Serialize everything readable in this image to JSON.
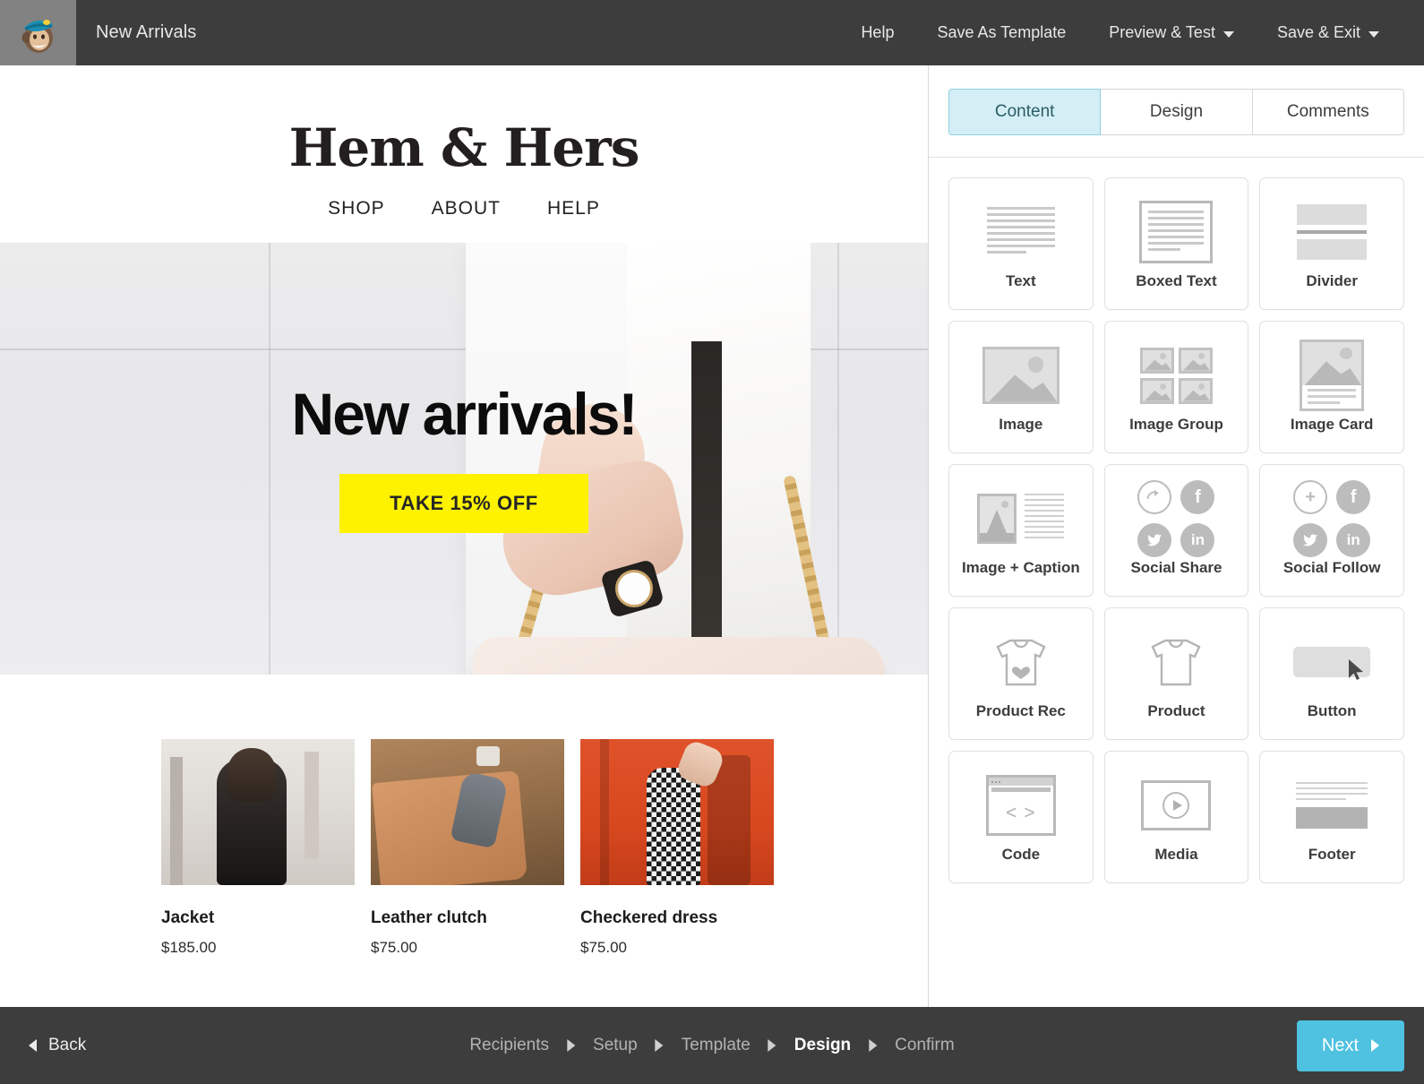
{
  "topbar": {
    "logo_icon": "mailchimp-freddie-logo",
    "campaign_title": "New Arrivals",
    "actions": [
      {
        "label": "Help",
        "caret": false
      },
      {
        "label": "Save As Template",
        "caret": false
      },
      {
        "label": "Preview & Test",
        "caret": true
      },
      {
        "label": "Save & Exit",
        "caret": true
      }
    ]
  },
  "email": {
    "brand_name": "Hem & Hers",
    "nav": [
      "SHOP",
      "ABOUT",
      "HELP"
    ],
    "hero": {
      "headline": "New arrivals!",
      "button_label": "TAKE 15% OFF",
      "button_color": "#fff200"
    },
    "products": [
      {
        "name": "Jacket",
        "price": "$185.00",
        "image": "woman-in-black-leather-jacket-on-street"
      },
      {
        "name": "Leather clutch",
        "price": "$75.00",
        "image": "tan-leather-clutch-with-gray-glove"
      },
      {
        "name": "Checkered dress",
        "price": "$75.00",
        "image": "checkered-dress-against-orange-wall"
      }
    ]
  },
  "panel": {
    "tabs": [
      {
        "label": "Content",
        "active": true
      },
      {
        "label": "Design",
        "active": false
      },
      {
        "label": "Comments",
        "active": false
      }
    ],
    "blocks": [
      {
        "label": "Text",
        "icon": "text-lines-icon"
      },
      {
        "label": "Boxed Text",
        "icon": "boxed-text-icon"
      },
      {
        "label": "Divider",
        "icon": "divider-icon"
      },
      {
        "label": "Image",
        "icon": "image-icon"
      },
      {
        "label": "Image Group",
        "icon": "image-group-icon"
      },
      {
        "label": "Image Card",
        "icon": "image-card-icon"
      },
      {
        "label": "Image + Caption",
        "icon": "image-caption-icon"
      },
      {
        "label": "Social Share",
        "icon": "social-share-icon"
      },
      {
        "label": "Social Follow",
        "icon": "social-follow-icon"
      },
      {
        "label": "Product Rec",
        "icon": "tshirt-heart-icon"
      },
      {
        "label": "Product",
        "icon": "tshirt-icon"
      },
      {
        "label": "Button",
        "icon": "button-cursor-icon"
      },
      {
        "label": "Code",
        "icon": "code-window-icon"
      },
      {
        "label": "Media",
        "icon": "media-play-icon"
      },
      {
        "label": "Footer",
        "icon": "footer-icon"
      }
    ]
  },
  "bottombar": {
    "back_label": "Back",
    "steps": [
      {
        "label": "Recipients",
        "current": false
      },
      {
        "label": "Setup",
        "current": false
      },
      {
        "label": "Template",
        "current": false
      },
      {
        "label": "Design",
        "current": true
      },
      {
        "label": "Confirm",
        "current": false
      }
    ],
    "next_label": "Next",
    "next_color": "#4ec2e0"
  }
}
